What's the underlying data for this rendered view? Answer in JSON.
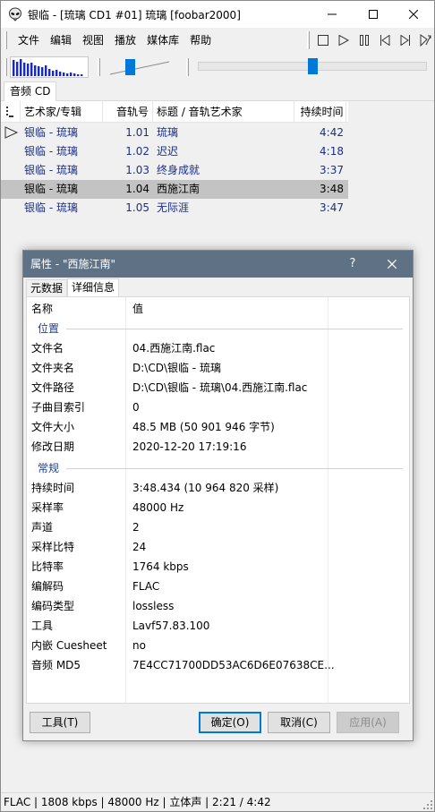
{
  "window": {
    "title": "银临 - [琉璃 CD1 #01] 琉璃  [foobar2000]"
  },
  "menu": [
    "文件",
    "编辑",
    "视图",
    "播放",
    "媒体库",
    "帮助"
  ],
  "transport_icons": [
    "stop-icon",
    "play-icon",
    "pause-icon",
    "previous-icon",
    "next-icon",
    "random-icon"
  ],
  "seekbar": {
    "position": 0.5
  },
  "volume": {
    "level": 0.35
  },
  "playlist_tab": "音频 CD",
  "playlist": {
    "columns": [
      "",
      "艺术家/专辑",
      "音轨号",
      "标题 / 音轨艺术家",
      "持续时间"
    ],
    "rows": [
      {
        "artist_album": "银临 - 琉璃",
        "track": "1.01",
        "title": "琉璃",
        "duration": "4:42",
        "playing": true,
        "selected": false
      },
      {
        "artist_album": "银临 - 琉璃",
        "track": "1.02",
        "title": "迟迟",
        "duration": "4:18",
        "playing": false,
        "selected": false
      },
      {
        "artist_album": "银临 - 琉璃",
        "track": "1.03",
        "title": "终身成就",
        "duration": "3:37",
        "playing": false,
        "selected": false
      },
      {
        "artist_album": "银临 - 琉璃",
        "track": "1.04",
        "title": "西施江南",
        "duration": "3:48",
        "playing": false,
        "selected": true
      },
      {
        "artist_album": "银临 - 琉璃",
        "track": "1.05",
        "title": "无际涯",
        "duration": "3:47",
        "playing": false,
        "selected": false
      }
    ]
  },
  "dialog": {
    "title": "属性 - \"西施江南\"",
    "help": "?",
    "tabs": [
      "元数据",
      "详细信息"
    ],
    "header": {
      "name": "名称",
      "value": "值"
    },
    "groups": [
      {
        "label": "位置",
        "rows": [
          {
            "name": "文件名",
            "value": "04.西施江南.flac"
          },
          {
            "name": "文件夹名",
            "value": "D:\\CD\\银临 - 琉璃"
          },
          {
            "name": "文件路径",
            "value": "D:\\CD\\银临 - 琉璃\\04.西施江南.flac"
          },
          {
            "name": "子曲目索引",
            "value": "0"
          },
          {
            "name": "文件大小",
            "value": "48.5 MB (50 901 946 字节)"
          },
          {
            "name": "修改日期",
            "value": "2020-12-20 17:19:16"
          }
        ]
      },
      {
        "label": "常规",
        "rows": [
          {
            "name": "持续时间",
            "value": "3:48.434 (10 964 820 采样)"
          },
          {
            "name": "采样率",
            "value": "48000 Hz"
          },
          {
            "name": "声道",
            "value": "2"
          },
          {
            "name": "采样比特",
            "value": "24"
          },
          {
            "name": "比特率",
            "value": "1764 kbps"
          },
          {
            "name": "编解码",
            "value": "FLAC"
          },
          {
            "name": "编码类型",
            "value": "lossless"
          },
          {
            "name": "工具",
            "value": "Lavf57.83.100"
          },
          {
            "name": "内嵌 Cuesheet",
            "value": "no"
          },
          {
            "name": "音频 MD5",
            "value": "7E4CC71700DD53AC6D6E07638CE..."
          }
        ]
      }
    ],
    "buttons": {
      "tools": "工具(T)",
      "ok": "确定(O)",
      "cancel": "取消(C)",
      "apply": "应用(A)"
    }
  },
  "status": "FLAC | 1808 kbps | 48000 Hz | 立体声 | 2:21 / 4:42"
}
